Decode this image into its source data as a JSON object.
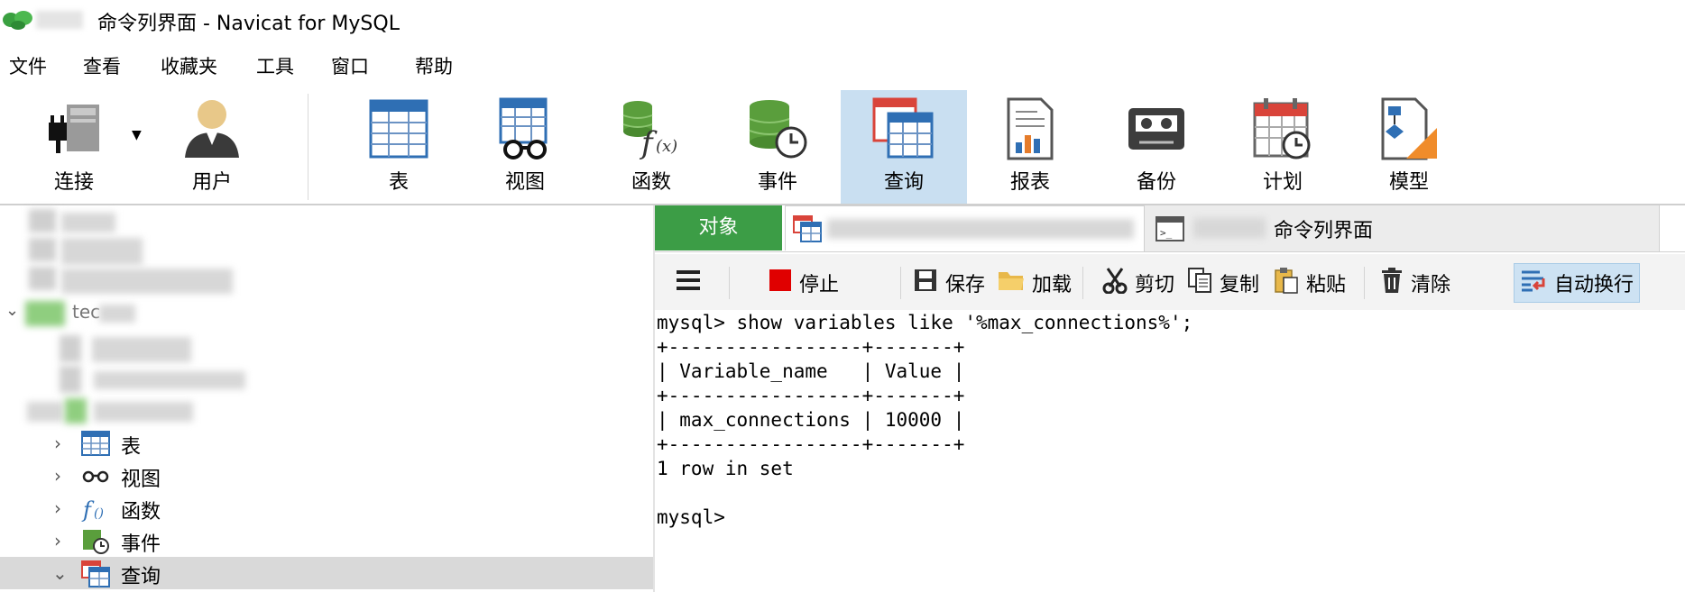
{
  "window": {
    "title": "命令列界面 - Navicat for MySQL"
  },
  "menu": [
    "文件",
    "查看",
    "收藏夹",
    "工具",
    "窗口",
    "帮助"
  ],
  "toolbar": {
    "connect": "连接",
    "user": "用户",
    "table": "表",
    "view": "视图",
    "function": "函数",
    "event": "事件",
    "query": "查询",
    "report": "报表",
    "backup": "备份",
    "schedule": "计划",
    "model": "模型",
    "active": "查询"
  },
  "tabs": {
    "objects": "对象",
    "console": "命令列界面"
  },
  "console_toolbar": {
    "stop": "停止",
    "save": "保存",
    "load": "加载",
    "cut": "剪切",
    "copy": "复制",
    "paste": "粘贴",
    "clear": "清除",
    "wrap": "自动换行"
  },
  "tree": {
    "db_partial": "tec",
    "items": [
      "表",
      "视图",
      "函数",
      "事件",
      "查询"
    ],
    "selected": "查询"
  },
  "console": {
    "lines": [
      "mysql> show variables like '%max_connections%';",
      "+-----------------+-------+",
      "| Variable_name   | Value |",
      "+-----------------+-------+",
      "| max_connections | 10000 |",
      "+-----------------+-------+",
      "1 row in set",
      "",
      "mysql>"
    ]
  },
  "colors": {
    "objects_tab": "#3c9d46",
    "active_tool": "#c9dff1",
    "stop_red": "#e00000"
  }
}
